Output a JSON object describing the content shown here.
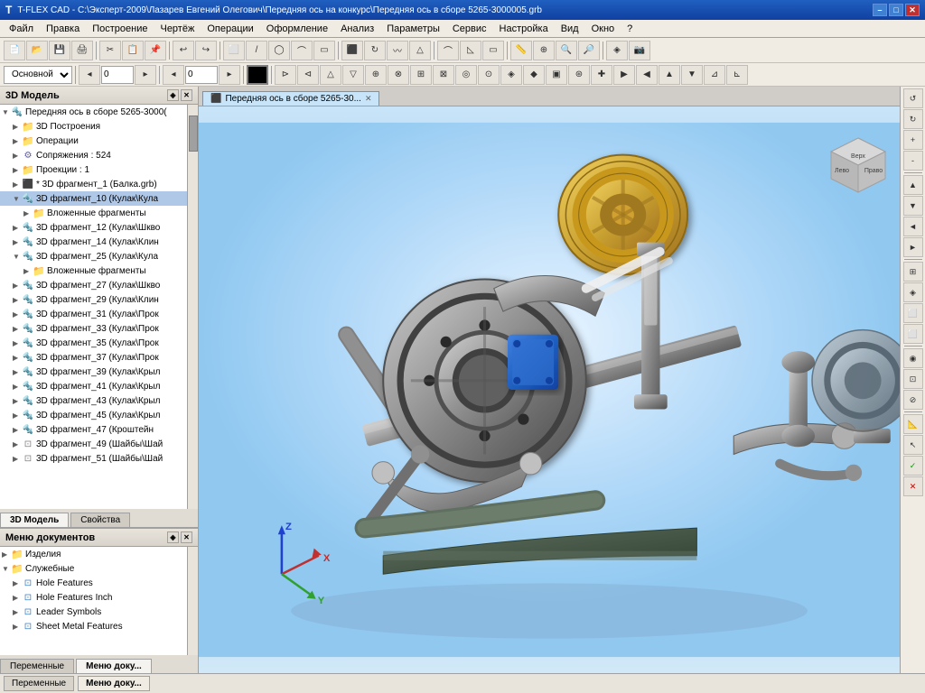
{
  "titlebar": {
    "icon": "T-FLEX",
    "title": "T-FLEX CAD - C:\\Эксперт-2009\\Лазарев Евгений Олегович\\Передняя ось на конкурс\\Передняя ось в сборе 5265-3000005.grb",
    "min": "–",
    "max": "□",
    "close": "✕"
  },
  "menubar": {
    "items": [
      "Файл",
      "Правка",
      "Построение",
      "Чертёж",
      "Операции",
      "Оформление",
      "Анализ",
      "Параметры",
      "Сервис",
      "Настройка",
      "Вид",
      "Окно",
      "?"
    ]
  },
  "toolbar": {
    "buttons": [
      "💾",
      "📂",
      "🖫",
      "✂",
      "📋",
      "↩",
      "↪",
      "📐",
      "⬜",
      "⬛",
      "◯",
      "△",
      "📏",
      "📐",
      "✎",
      "🔍",
      "🔎",
      "⊞",
      "⊟",
      "🔄",
      "📷",
      "🖨"
    ]
  },
  "toolbar2": {
    "combo1": "Основной",
    "val1": "0",
    "val2": "0",
    "buttons": [
      "◂",
      "⬛",
      "▸"
    ]
  },
  "model_panel": {
    "title": "3D Модель",
    "tree": [
      {
        "level": 0,
        "icon": "assembly",
        "label": "Передняя ось в сборе 5265-3000(",
        "expanded": true
      },
      {
        "level": 1,
        "icon": "folder",
        "label": "3D Построения",
        "expanded": false
      },
      {
        "level": 1,
        "icon": "folder",
        "label": "Операции",
        "expanded": false
      },
      {
        "level": 1,
        "icon": "gear",
        "label": "Сопряжения : 524",
        "expanded": false
      },
      {
        "level": 1,
        "icon": "folder",
        "label": "Проекции : 1",
        "expanded": false
      },
      {
        "level": 1,
        "icon": "part",
        "label": "* 3D фрагмент_1 (Балка.grb)",
        "expanded": false
      },
      {
        "level": 1,
        "icon": "assembly",
        "label": "3D фрагмент_10 (Кулак\\Кула",
        "expanded": true,
        "highlighted": true
      },
      {
        "level": 2,
        "icon": "folder",
        "label": "Вложенные фрагменты",
        "expanded": false
      },
      {
        "level": 1,
        "icon": "assembly",
        "label": "3D фрагмент_12 (Кулак\\Шкво",
        "expanded": false
      },
      {
        "level": 1,
        "icon": "assembly",
        "label": "3D фрагмент_14 (Кулак\\Клин",
        "expanded": false
      },
      {
        "level": 1,
        "icon": "assembly",
        "label": "3D фрагмент_25 (Кулак\\Кула",
        "expanded": true
      },
      {
        "level": 2,
        "icon": "folder",
        "label": "Вложенные фрагменты",
        "expanded": false
      },
      {
        "level": 1,
        "icon": "assembly",
        "label": "3D фрагмент_27 (Кулак\\Шкво",
        "expanded": false
      },
      {
        "level": 1,
        "icon": "assembly",
        "label": "3D фрагмент_29 (Кулак\\Клин",
        "expanded": false
      },
      {
        "level": 1,
        "icon": "assembly",
        "label": "3D фрагмент_31 (Кулак\\Прок",
        "expanded": false
      },
      {
        "level": 1,
        "icon": "assembly",
        "label": "3D фрагмент_33 (Кулак\\Прок",
        "expanded": false
      },
      {
        "level": 1,
        "icon": "assembly",
        "label": "3D фрагмент_35 (Кулак\\Прок",
        "expanded": false
      },
      {
        "level": 1,
        "icon": "assembly",
        "label": "3D фрагмент_37 (Кулак\\Прок",
        "expanded": false
      },
      {
        "level": 1,
        "icon": "assembly",
        "label": "3D фрагмент_39 (Кулак\\Крыл",
        "expanded": false
      },
      {
        "level": 1,
        "icon": "assembly",
        "label": "3D фрагмент_41 (Кулак\\Крыл",
        "expanded": false
      },
      {
        "level": 1,
        "icon": "assembly",
        "label": "3D фрагмент_43 (Кулак\\Крыл",
        "expanded": false
      },
      {
        "level": 1,
        "icon": "assembly",
        "label": "3D фрагмент_45 (Кулак\\Крыл",
        "expanded": false
      },
      {
        "level": 1,
        "icon": "assembly",
        "label": "3D фрагмент_47 (Кроштейн",
        "expanded": false
      },
      {
        "level": 1,
        "icon": "washer",
        "label": "3D фрагмент_49 (Шайбы\\Шай",
        "expanded": false
      },
      {
        "level": 1,
        "icon": "washer",
        "label": "3D фрагмент_51 (Шайбы\\Шай",
        "expanded": false
      }
    ]
  },
  "panel_tabs": {
    "tabs": [
      "3D Модель",
      "Свойства"
    ]
  },
  "doc_panel": {
    "title": "Меню документов",
    "tree": [
      {
        "level": 0,
        "icon": "folder",
        "label": "Изделия",
        "expanded": false
      },
      {
        "level": 0,
        "icon": "folder",
        "label": "Служебные",
        "expanded": true
      },
      {
        "level": 1,
        "icon": "feature",
        "label": "Hole Features",
        "expanded": false
      },
      {
        "level": 1,
        "icon": "feature",
        "label": "Hole Features Inch",
        "expanded": false
      },
      {
        "level": 1,
        "icon": "feature",
        "label": "Leader Symbols",
        "expanded": false
      },
      {
        "level": 1,
        "icon": "feature",
        "label": "Sheet Metal Features",
        "expanded": false
      }
    ]
  },
  "doc_panel_tabs": {
    "tabs": [
      "Переменные",
      "Меню доку..."
    ]
  },
  "view_tab": {
    "label": "Передняя ось в сборе 5265-30...",
    "icon": "3d-view-icon"
  },
  "statusbar": {
    "tabs": [
      "Переменные",
      "Меню доку..."
    ]
  },
  "right_toolbar": {
    "buttons": [
      "↖",
      "↗",
      "↘",
      "↙",
      "⟳",
      "⟲",
      "⊕",
      "⊗",
      "◱",
      "◳",
      "⬜",
      "◈",
      "⊞",
      "⊠",
      "◎",
      "⊙",
      "✦",
      "◆",
      "▣",
      "⊛",
      "✚",
      "▶",
      "◀"
    ]
  }
}
